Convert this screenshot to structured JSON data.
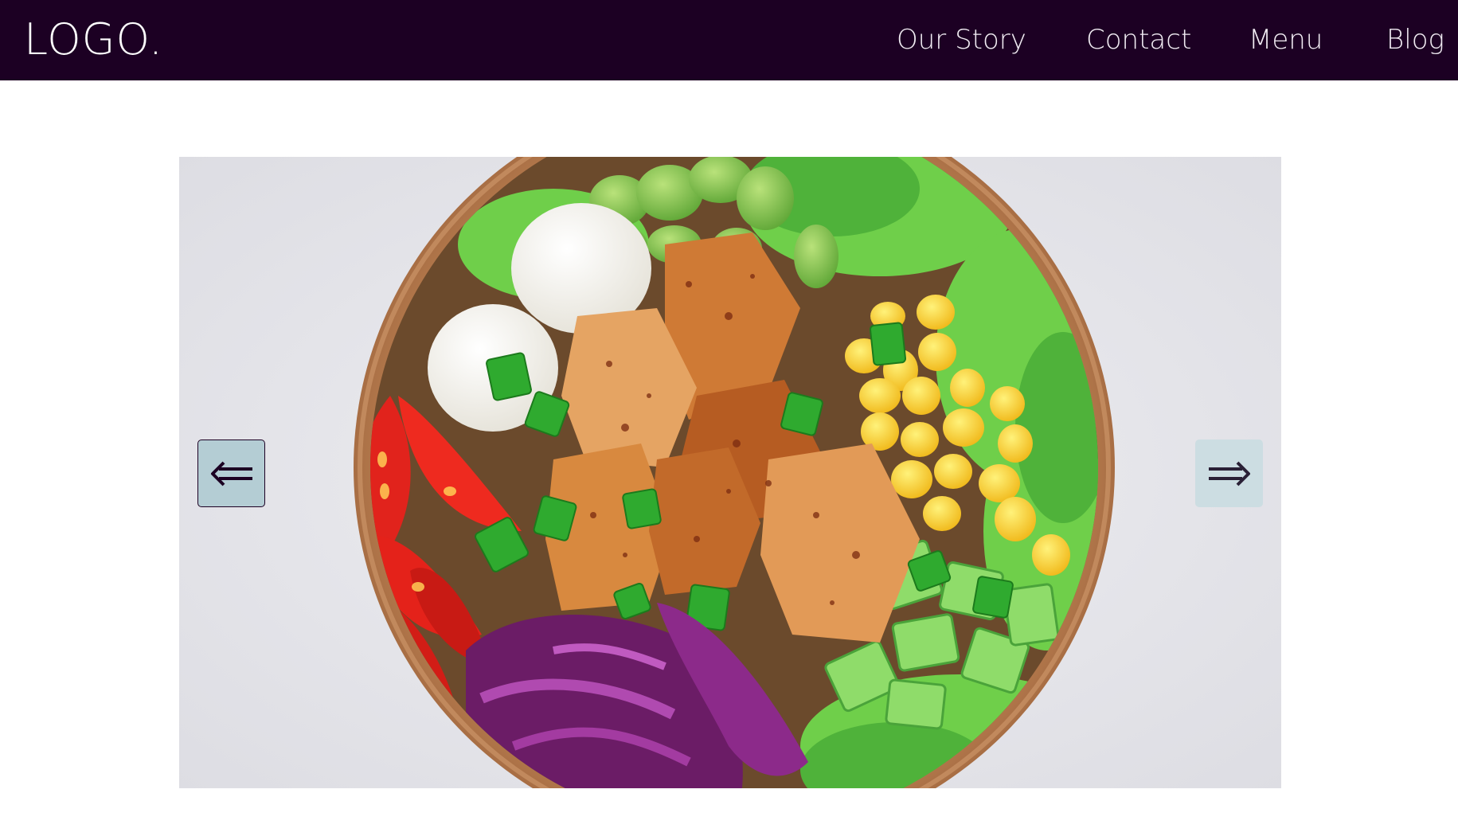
{
  "header": {
    "logo": "LOGO.",
    "nav": {
      "our_story": "Our Story",
      "contact": "Contact",
      "menu": "Menu",
      "blog": "Blog"
    }
  },
  "slider": {
    "image_alt": "",
    "prev_icon": "double-left-arrow-icon",
    "next_icon": "double-right-arrow-icon"
  },
  "colors": {
    "header_bg": "#1c0023",
    "nav_text": "#f1ecf3",
    "prev_button_bg": "#b4cdd4",
    "next_button_bg": "#ccdde2",
    "arrow_color": "#1c0023"
  }
}
